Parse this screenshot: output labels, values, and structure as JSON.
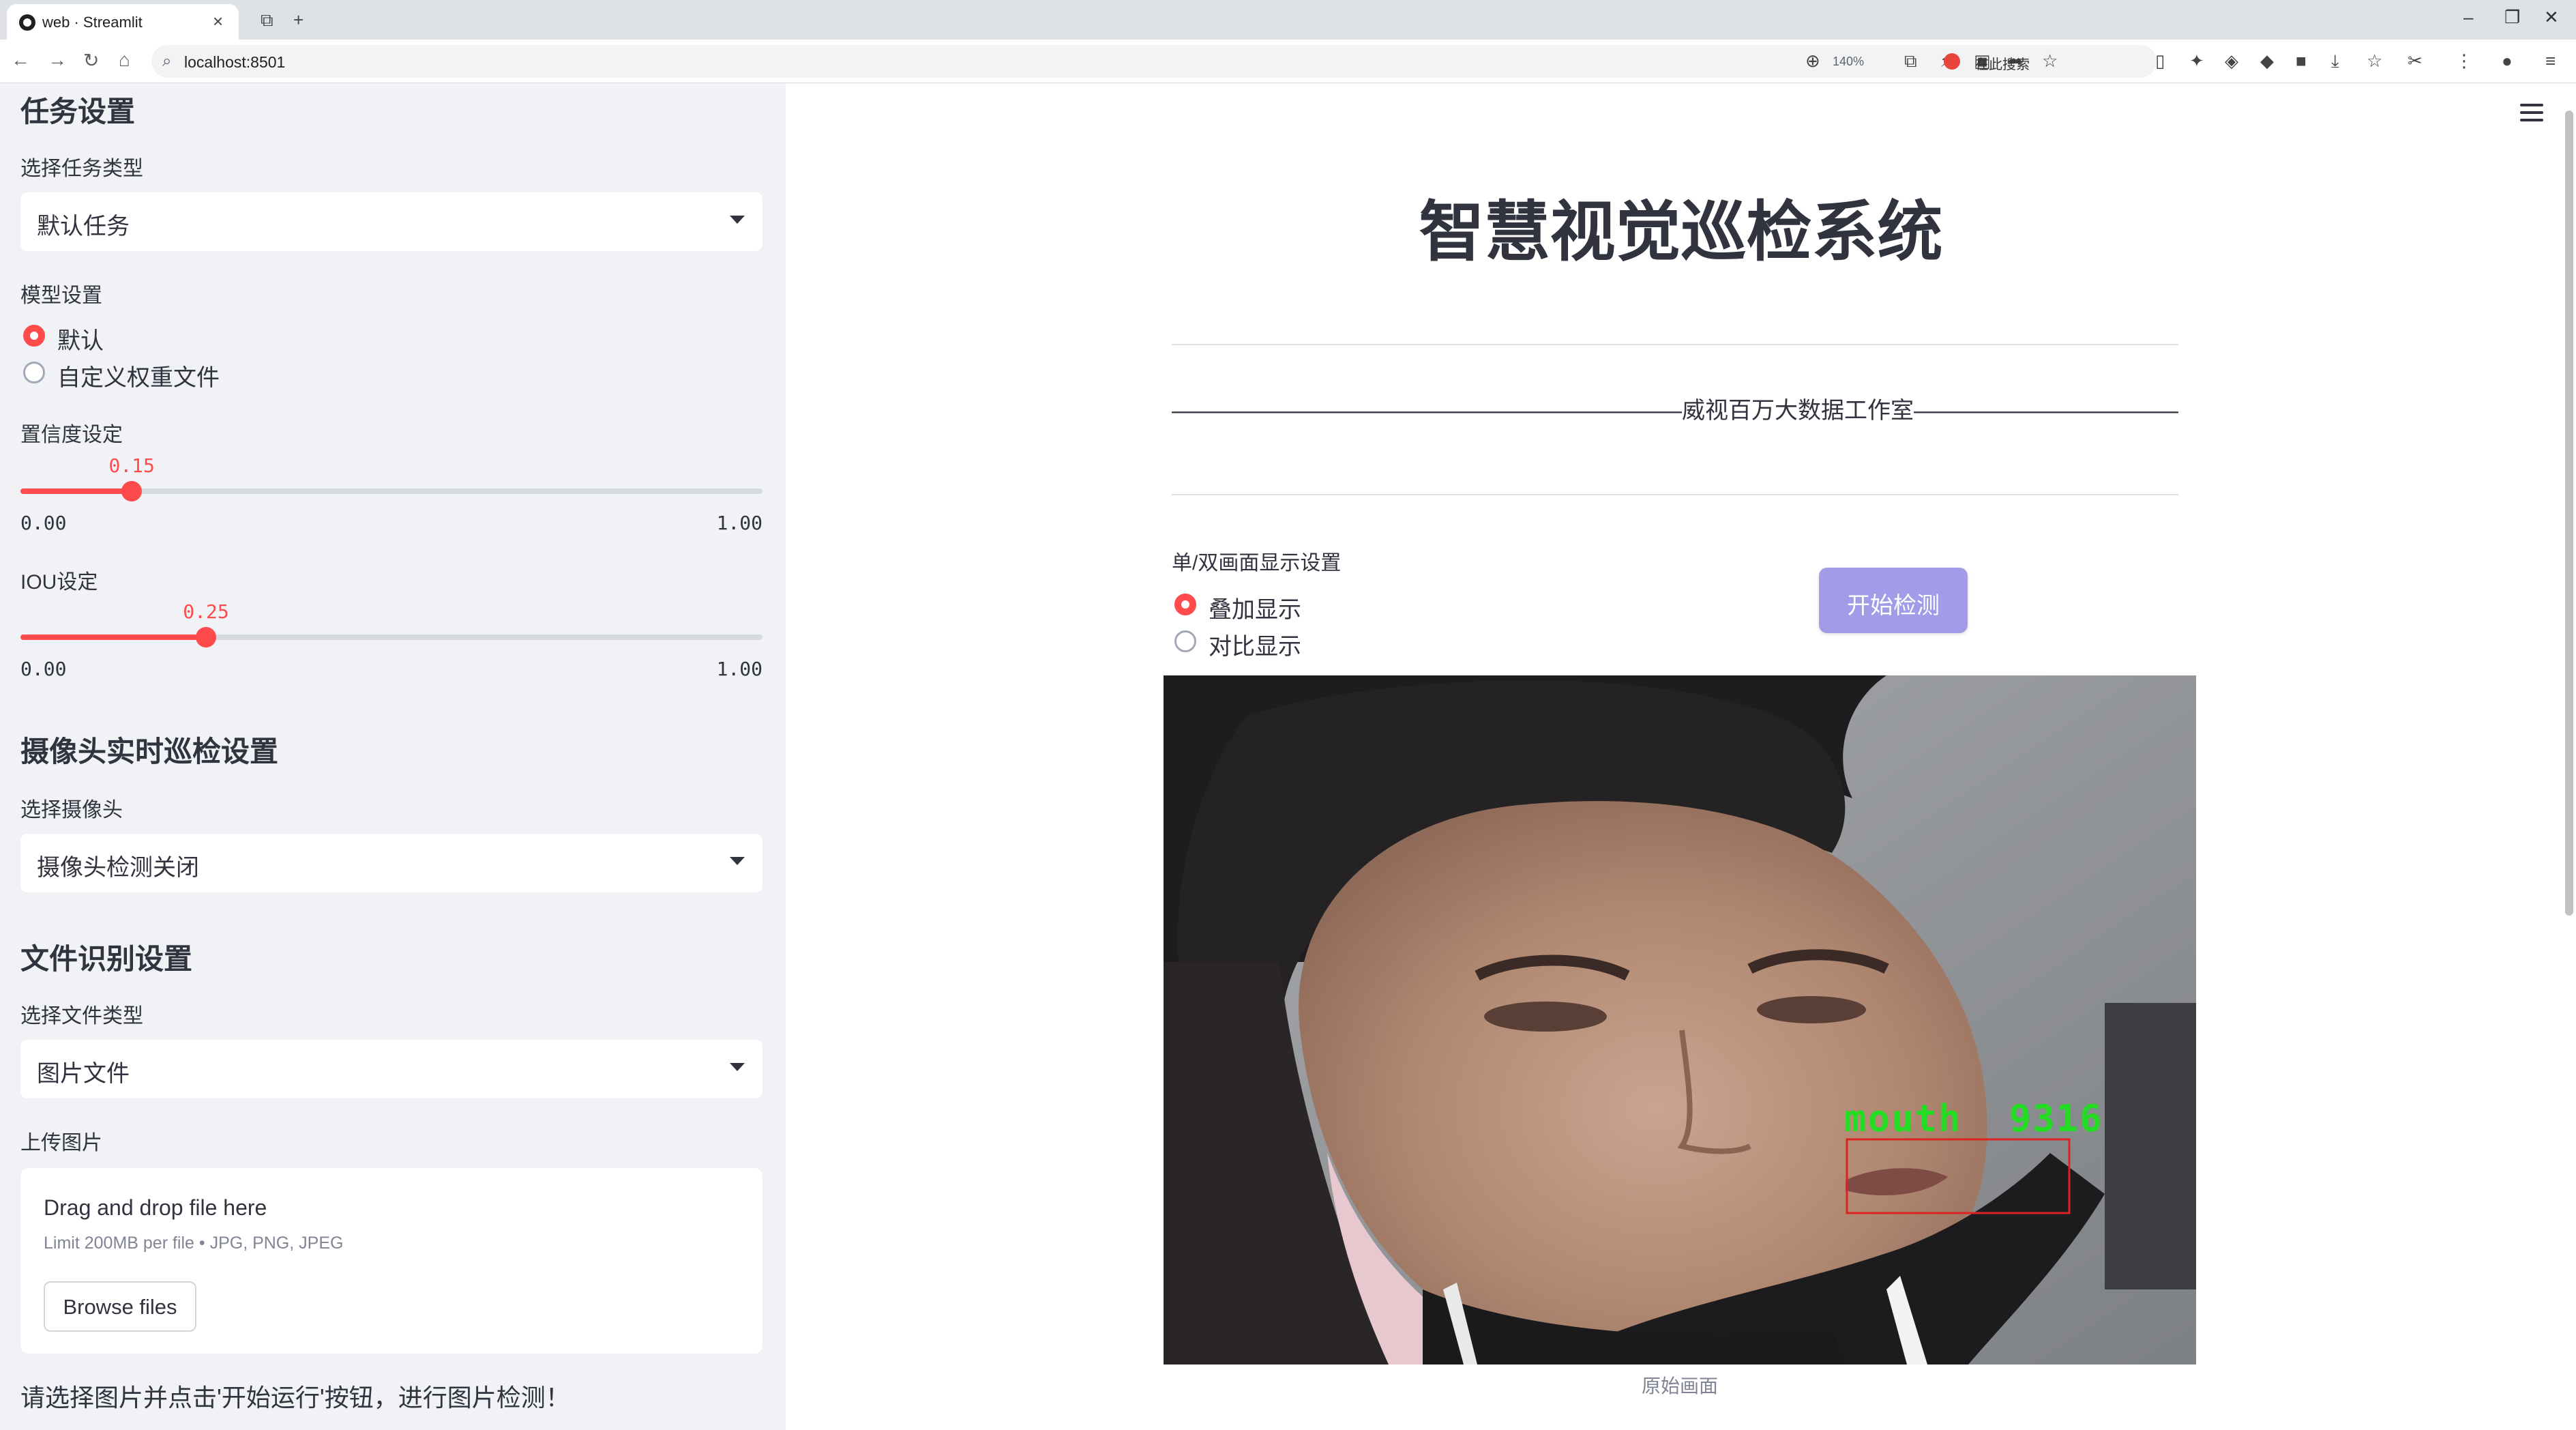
{
  "browser": {
    "tab_title": "web · Streamlit",
    "url": "localhost:8501",
    "zoom": "140%",
    "search_placeholder": "在此搜索"
  },
  "sidebar": {
    "task_section": {
      "heading": "任务设置",
      "task_type_label": "选择任务类型",
      "task_type_value": "默认任务"
    },
    "model_section": {
      "label": "模型设置",
      "options": [
        "默认",
        "自定义权重文件"
      ],
      "selected": 0
    },
    "confidence": {
      "label": "置信度设定",
      "value": "0.15",
      "min": "0.00",
      "max": "1.00",
      "fraction": 0.15
    },
    "iou": {
      "label": "IOU设定",
      "value": "0.25",
      "min": "0.00",
      "max": "1.00",
      "fraction": 0.25
    },
    "camera_section": {
      "heading": "摄像头实时巡检设置",
      "label": "选择摄像头",
      "value": "摄像头检测关闭"
    },
    "file_section": {
      "heading": "文件识别设置",
      "type_label": "选择文件类型",
      "type_value": "图片文件",
      "upload_label": "上传图片",
      "dropzone_title": "Drag and drop file here",
      "dropzone_limit": "Limit 200MB per file • JPG, PNG, JPEG",
      "browse_button": "Browse files"
    },
    "hint": "请选择图片并点击'开始运行'按钮，进行图片检测！"
  },
  "main": {
    "title": "智慧视觉巡检系统",
    "subtitle": "——————————————————————威视百万大数据工作室———————————————————————",
    "display_label": "单/双画面显示设置",
    "display_options": [
      "叠加显示",
      "对比显示"
    ],
    "display_selected": 0,
    "start_button": "开始检测",
    "detection_label": "mouth  9316",
    "image_caption": "原始画面"
  },
  "colors": {
    "accent": "#ff4b4b",
    "button": "#a19be8",
    "sidebar_bg": "#f0f2f6",
    "detection_text": "#22dd22",
    "detection_box": "#dd2222"
  }
}
